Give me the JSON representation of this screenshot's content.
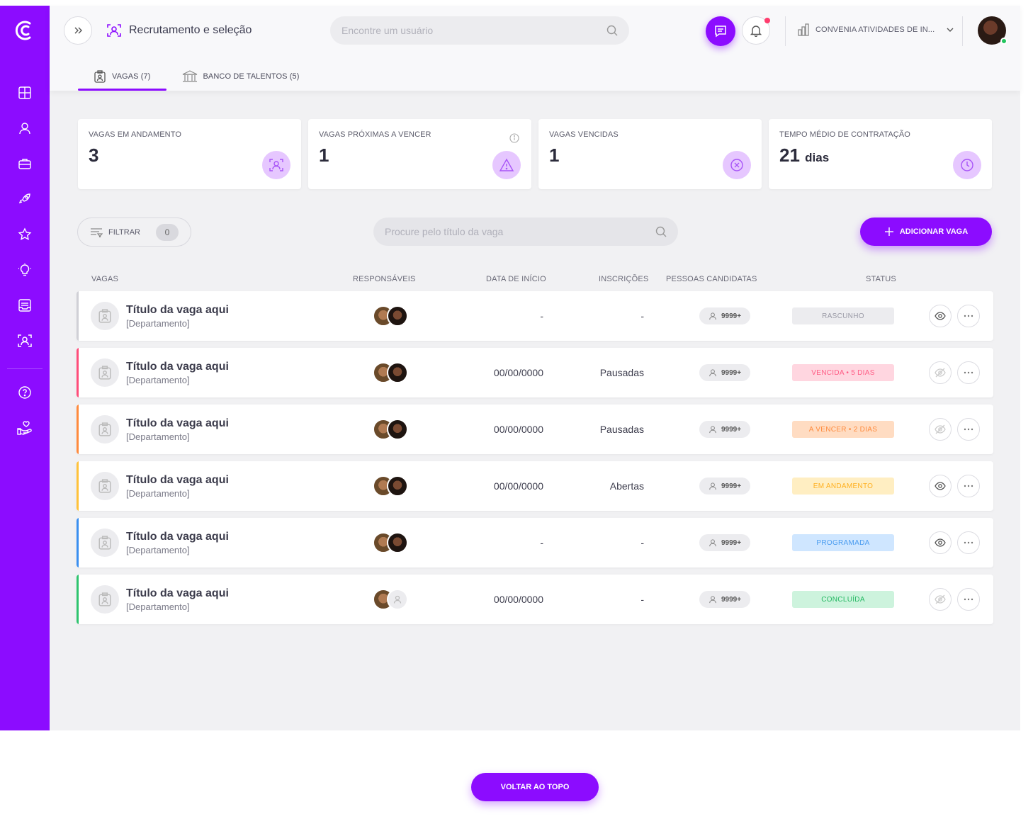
{
  "header": {
    "title": "Recrutamento e seleção",
    "search_placeholder": "Encontre um usuário",
    "company": "CONVENIA ATIVIDADES DE IN..."
  },
  "tabs": [
    {
      "label": "VAGAS (7)",
      "active": true
    },
    {
      "label": "BANCO DE TALENTOS (5)",
      "active": false
    }
  ],
  "sidebar": {
    "items": [
      "dashboard-icon",
      "person-icon",
      "briefcase-icon",
      "rocket-icon",
      "star-icon",
      "lightbulb-icon",
      "inbox-icon",
      "recruitment-icon",
      "help-icon",
      "hand-heart-icon"
    ]
  },
  "stats": [
    {
      "label": "VAGAS EM ANDAMENTO",
      "value": "3",
      "unit": ""
    },
    {
      "label": "VAGAS PRÓXIMAS A VENCER",
      "value": "1",
      "unit": ""
    },
    {
      "label": "VAGAS VENCIDAS",
      "value": "1",
      "unit": ""
    },
    {
      "label": "TEMPO MÉDIO DE CONTRATAÇÃO",
      "value": "21",
      "unit": "dias"
    }
  ],
  "toolbar": {
    "filter_label": "FILTRAR",
    "filter_count": "0",
    "search_placeholder": "Procure pelo título da vaga",
    "add_label": "ADICIONAR VAGA"
  },
  "table": {
    "headers": {
      "vagas": "VAGAS",
      "responsaveis": "RESPONSÁVEIS",
      "data_inicio": "DATA DE INÍCIO",
      "inscricoes": "INSCRIÇÕES",
      "pessoas": "PESSOAS CANDIDATAS",
      "status": "STATUS"
    },
    "rows": [
      {
        "title": "Título da vaga aqui",
        "dept": "[Departamento]",
        "date": "-",
        "insc": "-",
        "count": "9999+",
        "status": "RASCUNHO",
        "status_bg": "#ececef",
        "status_fg": "#9a9aa6",
        "bar": "#d0d0d6",
        "eye_active": true
      },
      {
        "title": "Título da vaga aqui",
        "dept": "[Departamento]",
        "date": "00/00/0000",
        "insc": "Pausadas",
        "count": "9999+",
        "status": "VENCIDA • 5 DIAS",
        "status_bg": "#ffd6e0",
        "status_fg": "#ff5c85",
        "bar": "#ff4d7a",
        "eye_active": false
      },
      {
        "title": "Título da vaga aqui",
        "dept": "[Departamento]",
        "date": "00/00/0000",
        "insc": "Pausadas",
        "count": "9999+",
        "status": "A VENCER • 2 DIAS",
        "status_bg": "#ffdcc2",
        "status_fg": "#ff8a3c",
        "bar": "#ff8a3c",
        "eye_active": false
      },
      {
        "title": "Título da vaga aqui",
        "dept": "[Departamento]",
        "date": "00/00/0000",
        "insc": "Abertas",
        "count": "9999+",
        "status": "EM ANDAMENTO",
        "status_bg": "#ffeec2",
        "status_fg": "#ffb020",
        "bar": "#ffc23a",
        "eye_active": true
      },
      {
        "title": "Título da vaga aqui",
        "dept": "[Departamento]",
        "date": "-",
        "insc": "-",
        "count": "9999+",
        "status": "PROGRAMADA",
        "status_bg": "#cfe6ff",
        "status_fg": "#4a9cf0",
        "bar": "#3a8ff0",
        "eye_active": true
      },
      {
        "title": "Título da vaga aqui",
        "dept": "[Departamento]",
        "date": "00/00/0000",
        "insc": "-",
        "count": "9999+",
        "status": "CONCLUÍDA",
        "status_bg": "#cdf3dd",
        "status_fg": "#24b862",
        "bar": "#2ec46e",
        "eye_active": false
      }
    ]
  },
  "footer": {
    "back_to_top": "VOLTAR AO TOPO"
  },
  "colors": {
    "brand": "#8c0cff",
    "accent_light": "#e6c7ff"
  }
}
